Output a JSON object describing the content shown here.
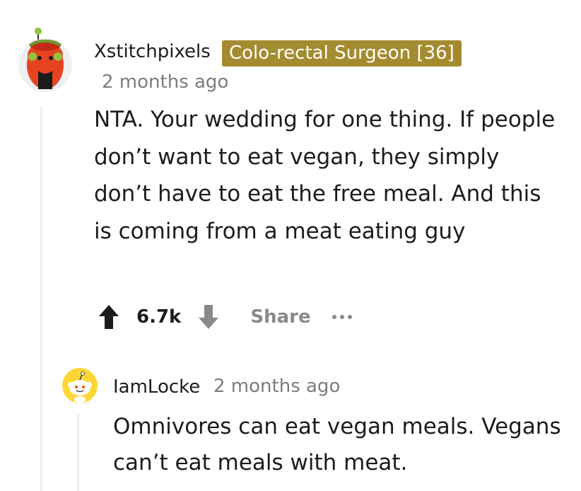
{
  "comment": {
    "username": "Xstitchpixels",
    "flair": "Colo-rectal Surgeon [36]",
    "timestamp": "2 months ago",
    "body": "NTA. Your wedding for one thing. If people don’t want to eat vegan, they simply don’t have to eat the free meal. And this is coming from a meat eating guy",
    "score": "6.7k",
    "share_label": "Share",
    "colors": {
      "flair_bg": "#a48b2f",
      "upvote": "#1c1c1c",
      "downvote": "#878a8c",
      "muted": "#878a8c"
    }
  },
  "reply": {
    "username": "IamLocke",
    "timestamp": "2 months ago",
    "body": "Omnivores can eat vegan meals. Vegans can’t eat meals with meat."
  },
  "icons": {
    "upvote": "upvote-arrow-icon",
    "downvote": "downvote-arrow-icon",
    "more": "more-options-icon",
    "avatar_main": "snoo-avatar-icon",
    "avatar_reply": "snoo-avatar-icon"
  }
}
